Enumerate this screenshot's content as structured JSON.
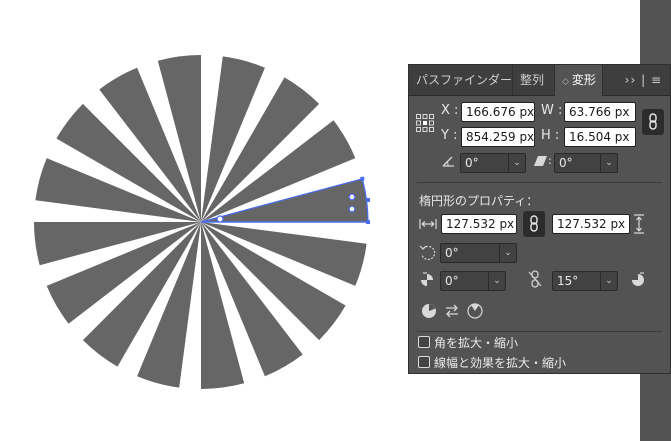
{
  "tabs": [
    {
      "label": "パスファインダー",
      "active": false
    },
    {
      "label": "整列",
      "active": false
    },
    {
      "label": "変形",
      "active": true
    }
  ],
  "tab_sort_glyph": "◇",
  "panel_menu_glyph": "›› | ≡",
  "transform": {
    "x_label": "X :",
    "x_value": "166.676 px",
    "y_label": "Y :",
    "y_value": "854.259 px",
    "w_label": "W :",
    "w_value": "63.766 px",
    "h_label": "H :",
    "h_value": "16.504 px",
    "rotate_value": "0°",
    "shear_value": "0°"
  },
  "ellipse": {
    "heading": "楕円形のプロパティ：",
    "width_value": "127.532 px",
    "height_value": "127.532 px",
    "rotation_value": "0°",
    "pie_start_value": "0°",
    "pie_end_value": "15°"
  },
  "options": {
    "scale_corners_label": "角を拡大・縮小",
    "scale_corners_checked": false,
    "scale_strokes_label": "線幅と効果を拡大・縮小",
    "scale_strokes_checked": false
  },
  "colors": {
    "wedge_fill": "#666666",
    "selection_blue": "#4a6cf7",
    "panel_bg": "#535353"
  },
  "artwork": {
    "wedge_count": 16,
    "wedge_sweep_degrees": 15
  }
}
